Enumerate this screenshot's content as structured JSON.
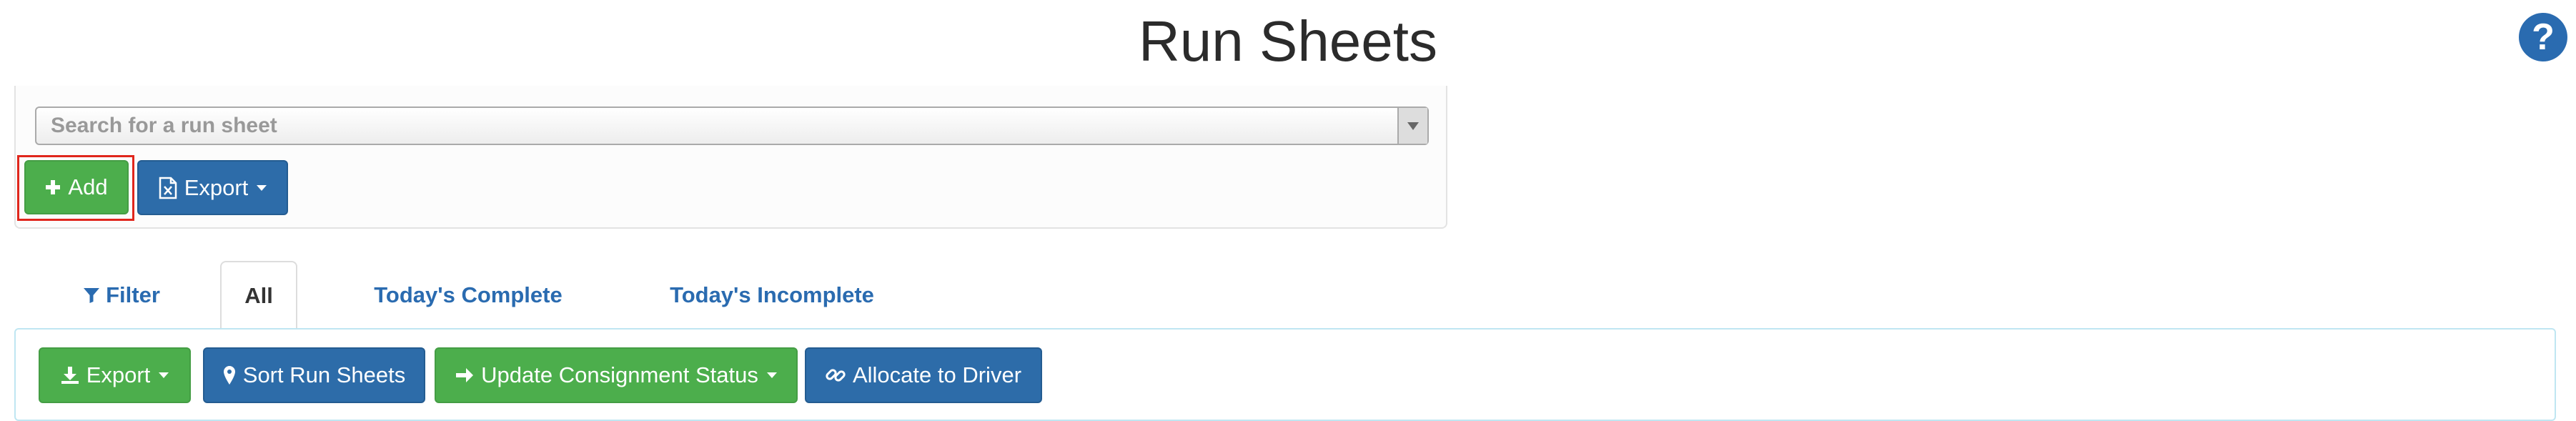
{
  "header": {
    "title": "Run Sheets",
    "help_icon": "question-circle-icon"
  },
  "search": {
    "placeholder": "Search for a run sheet"
  },
  "actions": {
    "add_label": "Add",
    "export_label": "Export"
  },
  "tabs": [
    {
      "label": "Filter",
      "icon": "filter-icon"
    },
    {
      "label": "All"
    },
    {
      "label": "Today's Complete"
    },
    {
      "label": "Today's Incomplete"
    }
  ],
  "toolbar": {
    "export_label": "Export",
    "sort_label": "Sort Run Sheets",
    "update_status_label": "Update Consignment Status",
    "allocate_label": "Allocate to Driver"
  },
  "colors": {
    "green": "#4cae4c",
    "blue": "#2d6ca9",
    "link": "#2a6bb0",
    "highlight": "#e0261c"
  }
}
